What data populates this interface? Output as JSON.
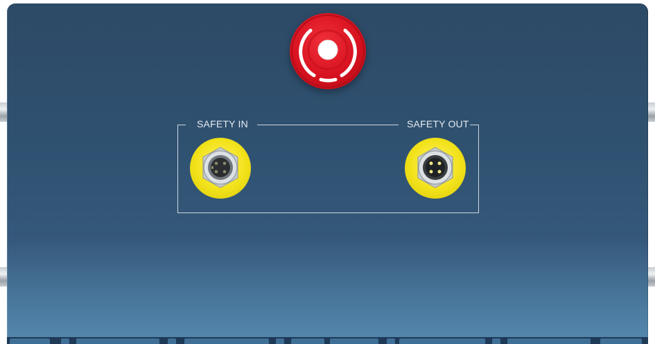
{
  "safety_panel": {
    "input_label": "SAFETY IN",
    "output_label": "SAFETY OUT"
  },
  "colors": {
    "panel": "#2f5170",
    "estop_red": "#d7111f",
    "connector_yellow": "#f2e21a",
    "frame_line": "#cfd6dd"
  },
  "icons": {
    "emergency_stop": "emergency-stop-icon",
    "safety_in_connector": "m8-female-connector-icon",
    "safety_out_connector": "m8-male-connector-icon"
  }
}
